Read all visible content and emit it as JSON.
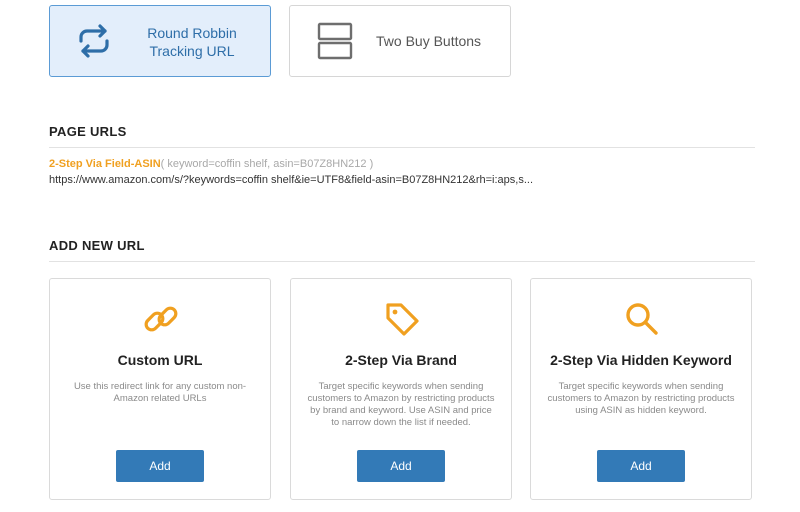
{
  "url_types": [
    {
      "label": "Round Robbin Tracking URL",
      "selected": true,
      "icon": "refresh-arrows-icon"
    },
    {
      "label": "Two Buy Buttons",
      "selected": false,
      "icon": "two-rectangles-icon"
    }
  ],
  "page_urls": {
    "title": "PAGE URLS",
    "items": [
      {
        "name": "2-Step Via Field-ASIN",
        "params": "( keyword=coffin shelf, asin=B07Z8HN212 )",
        "url": "https://www.amazon.com/s/?keywords=coffin shelf&ie=UTF8&field-asin=B07Z8HN212&rh=i:aps,s..."
      }
    ]
  },
  "add_new_url": {
    "title": "ADD NEW URL",
    "cards": [
      {
        "icon": "link-icon",
        "title": "Custom URL",
        "description": "Use this redirect link for any custom non-Amazon related URLs",
        "button": "Add"
      },
      {
        "icon": "tag-icon",
        "title": "2-Step Via Brand",
        "description": "Target specific keywords when sending customers to Amazon by restricting products by brand and keyword. Use ASIN and price to narrow down the list if needed.",
        "button": "Add"
      },
      {
        "icon": "search-icon",
        "title": "2-Step Via Hidden Keyword",
        "description": "Target specific keywords when sending customers to Amazon by restricting products using ASIN as hidden keyword.",
        "button": "Add"
      }
    ]
  },
  "colors": {
    "accent_orange": "#f0a020",
    "primary_blue": "#337ab7",
    "selected_bg": "#e3eefb",
    "selected_border": "#5b9bd5"
  }
}
